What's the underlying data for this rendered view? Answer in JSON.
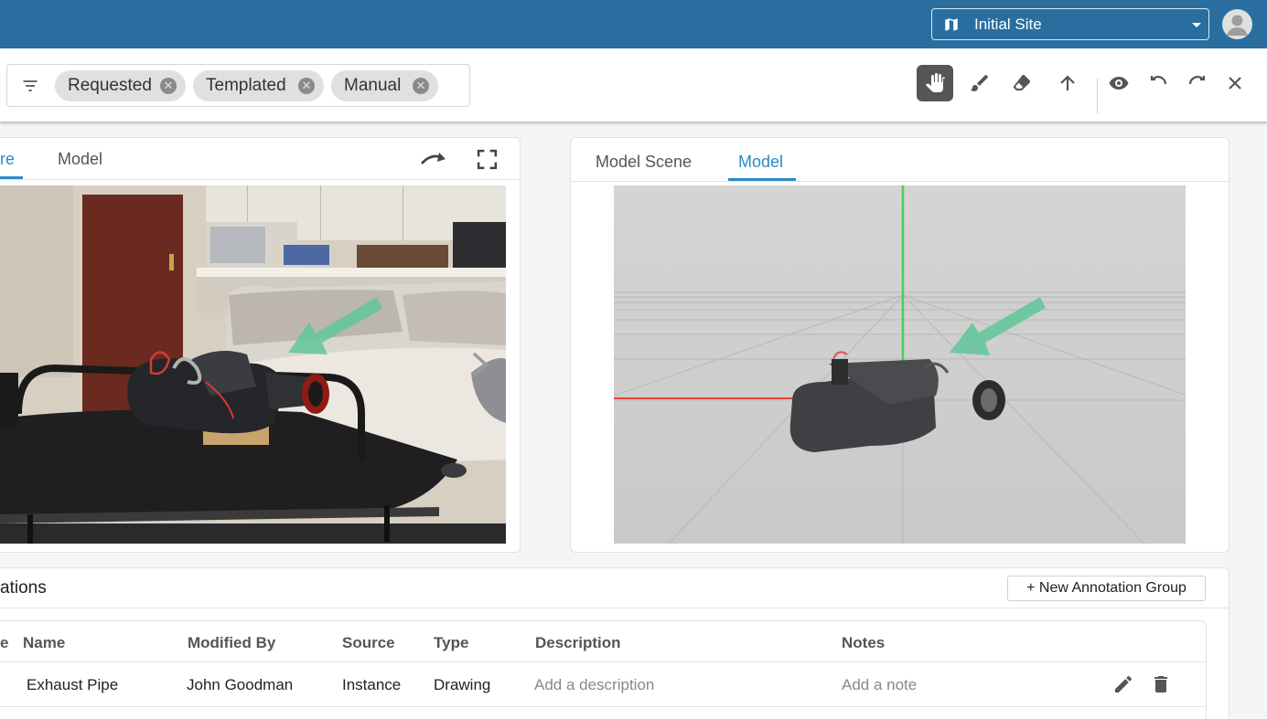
{
  "header": {
    "site_selector": {
      "icon": "map-icon",
      "value": "Initial Site"
    },
    "avatar_icon": "user-avatar-icon"
  },
  "toolbar": {
    "filter_icon": "filter-list-icon",
    "filter_chips": [
      {
        "label": "Requested"
      },
      {
        "label": "Templated"
      },
      {
        "label": "Manual"
      }
    ],
    "tools": [
      {
        "name": "pan-tool",
        "icon": "hand-icon",
        "active": true
      },
      {
        "name": "brush-tool",
        "icon": "brush-icon",
        "active": false
      },
      {
        "name": "eraser-tool",
        "icon": "eraser-icon",
        "active": false
      },
      {
        "name": "arrow-tool",
        "icon": "arrow-up-icon",
        "active": false
      },
      {
        "name": "visibility",
        "icon": "eye-icon",
        "active": false
      },
      {
        "name": "undo",
        "icon": "undo-icon",
        "active": false
      },
      {
        "name": "redo",
        "icon": "redo-icon",
        "active": false
      },
      {
        "name": "close",
        "icon": "close-icon",
        "active": false
      }
    ]
  },
  "left_panel": {
    "tabs": [
      {
        "label": "re",
        "active": true
      },
      {
        "label": "Model",
        "active": false
      }
    ],
    "actions": [
      "redo-arrow-icon",
      "fullscreen-icon"
    ],
    "next_icon": "chevron-right-icon"
  },
  "right_panel": {
    "tabs": [
      {
        "label": "Model Scene",
        "active": false
      },
      {
        "label": "Model",
        "active": true
      }
    ]
  },
  "annotations": {
    "title": "ations",
    "new_group_button": "+ New Annotation Group",
    "columns": [
      "e",
      "Name",
      "Modified By",
      "Source",
      "Type",
      "Description",
      "Notes"
    ],
    "rows": [
      {
        "name": "Exhaust Pipe",
        "modified_by": "John Goodman",
        "source": "Instance",
        "type": "Drawing",
        "description": "Add a description",
        "notes": "Add a note"
      }
    ]
  },
  "colors": {
    "header_bg": "#2a6e9f",
    "accent": "#2a8bc4",
    "annotation_arrow": "#5fc79a"
  }
}
